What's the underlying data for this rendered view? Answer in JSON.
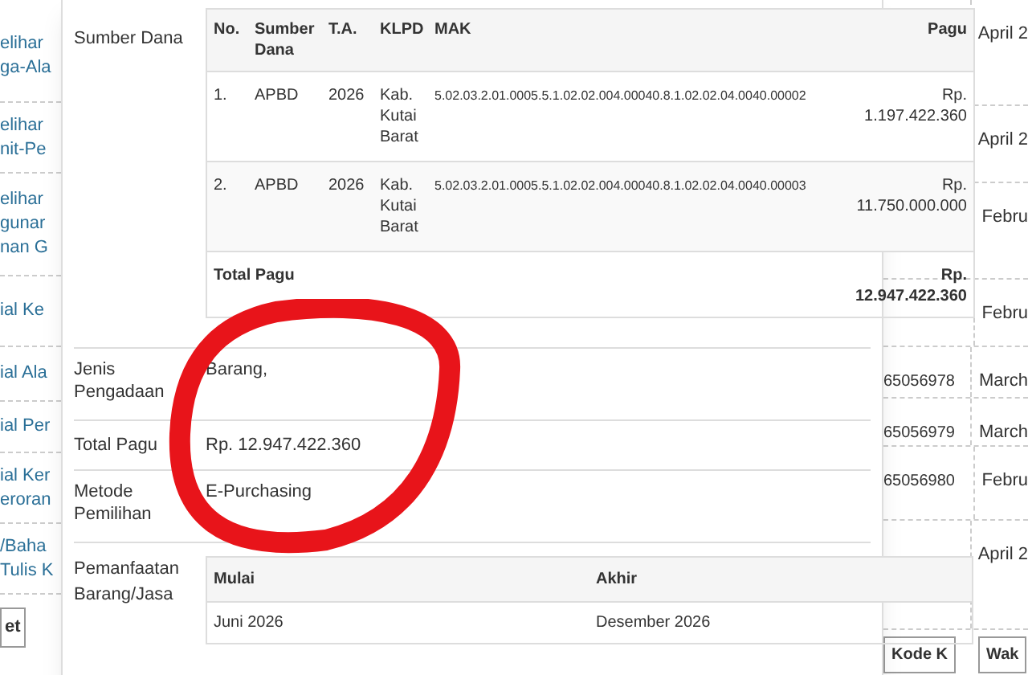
{
  "background": {
    "left_links": [
      {
        "lines": [
          "elihar",
          "ga-Ala"
        ]
      },
      {
        "lines": [
          "elihar",
          "nit-Pe"
        ]
      },
      {
        "lines": [
          "elihar",
          "gunar",
          "nan G"
        ]
      },
      {
        "lines": [
          "ial Ke"
        ]
      },
      {
        "lines": [
          "ial Ala"
        ]
      },
      {
        "lines": [
          "ial Per"
        ]
      },
      {
        "lines": [
          "ial Ker",
          "eroran"
        ]
      },
      {
        "lines": [
          "/Baha",
          "Tulis K"
        ]
      }
    ],
    "left_button": "et",
    "right_rows": [
      {
        "date": "April 2"
      },
      {
        "date": "April 2"
      },
      {
        "date": "Febru"
      },
      {
        "date": "Febru"
      },
      {
        "code": "65056978",
        "date": "March"
      },
      {
        "code": "65056979",
        "date": "March"
      },
      {
        "code": "65056980",
        "date": "Febru"
      },
      {
        "date": "April 2"
      }
    ],
    "right_buttons": [
      "Kode K",
      "Wak"
    ]
  },
  "detail": {
    "sumber_dana": {
      "label": "Sumber Dana",
      "columns": [
        "No.",
        "Sumber Dana",
        "T.A.",
        "KLPD",
        "MAK",
        "Pagu"
      ],
      "rows": [
        [
          "1.",
          "APBD",
          "2026",
          "Kab. Kutai Barat",
          "5.02.03.2.01.0005.5.1.02.02.004.00040.8.1.02.02.04.0040.00002",
          "Rp. 1.197.422.360"
        ],
        [
          "2.",
          "APBD",
          "2026",
          "Kab. Kutai Barat",
          "5.02.03.2.01.0005.5.1.02.02.004.00040.8.1.02.02.04.0040.00003",
          "Rp. 11.750.000.000"
        ]
      ],
      "total_label": "Total Pagu",
      "total_value": "Rp. 12.947.422.360"
    },
    "fields": [
      {
        "label": "Jenis Pengadaan",
        "value": "Barang,"
      },
      {
        "label": "Total Pagu",
        "value": "Rp. 12.947.422.360"
      },
      {
        "label": "Metode Pemilihan",
        "value": "E-Purchasing"
      }
    ],
    "pemanfaatan": {
      "label": "Pemanfaatan Barang/Jasa",
      "columns": [
        "Mulai",
        "Akhir"
      ],
      "row": [
        "Juni 2026",
        "Desember 2026"
      ]
    }
  }
}
